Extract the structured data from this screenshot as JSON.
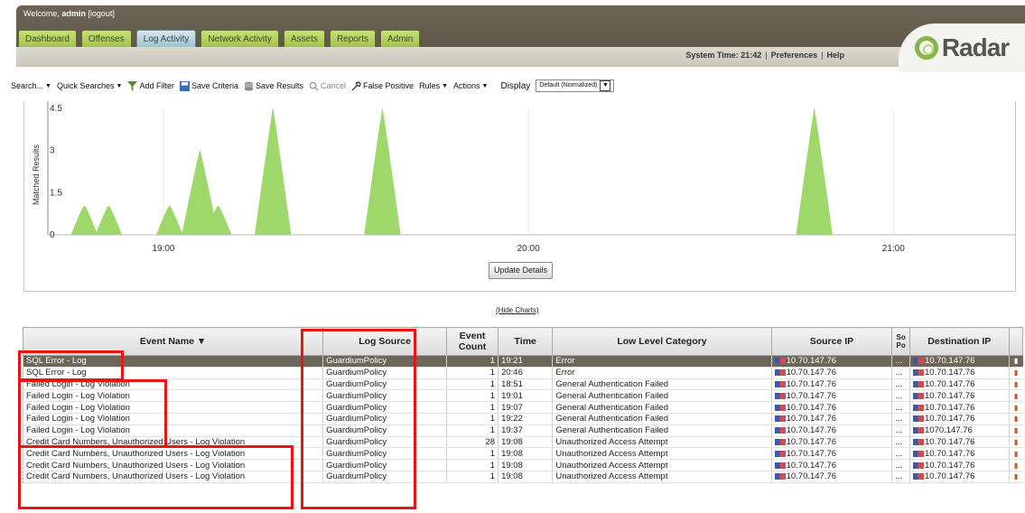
{
  "header": {
    "welcome_prefix": "Welcome, ",
    "user": "admin",
    "logout": "[logout]",
    "tabs": [
      {
        "label": "Dashboard"
      },
      {
        "label": "Offenses"
      },
      {
        "label": "Log Activity"
      },
      {
        "label": "Network Activity"
      },
      {
        "label": "Assets"
      },
      {
        "label": "Reports"
      },
      {
        "label": "Admin"
      }
    ],
    "active_tab": "Log Activity",
    "system_time_label": "System Time: 21:42",
    "preferences": "Preferences",
    "help": "Help",
    "logo_text": "Radar"
  },
  "toolbar": {
    "search": "Search...",
    "quick_searches": "Quick Searches",
    "add_filter": "Add Filter",
    "save_criteria": "Save Criteria",
    "save_results": "Save Results",
    "cancel": "Cancel",
    "false_positive": "False Positive",
    "rules": "Rules",
    "actions": "Actions",
    "display_label": "Display",
    "display_value": "Default (Normalized)"
  },
  "chart_data": {
    "type": "area",
    "ylabel": "Matched Results",
    "y_ticks": [
      "0",
      "1.5",
      "3",
      "4.5"
    ],
    "ylim": [
      0,
      4.5
    ],
    "x_ticks": [
      "19:00",
      "20:00",
      "21:00"
    ],
    "x_tick_minutes": [
      0,
      60,
      120
    ],
    "x_range_minutes": [
      -19,
      140
    ],
    "color": "#9ed86a",
    "peaks": [
      {
        "minute": -13,
        "value": 1
      },
      {
        "minute": -9,
        "value": 1
      },
      {
        "minute": 1,
        "value": 1
      },
      {
        "minute": 6,
        "value": 3
      },
      {
        "minute": 9,
        "value": 1
      },
      {
        "minute": 18,
        "value": 4.5
      },
      {
        "minute": 36,
        "value": 4.5
      },
      {
        "minute": 107,
        "value": 4.5
      }
    ],
    "update_button": "Update Details",
    "hide_charts": "(Hide Charts)"
  },
  "table": {
    "columns": [
      "Event Name ▼",
      "Log Source",
      "Event Count",
      "Time",
      "Low Level Category",
      "Source IP",
      "So Po",
      "Destination IP"
    ],
    "rows": [
      {
        "event_name": "SQL Error - Log",
        "log_source": "GuardiumPolicy",
        "count": "1",
        "time": "19:21",
        "category": "Error",
        "source_ip": "10.70.147.76",
        "sp": "...",
        "dest_ip": "10.70.147.76",
        "selected": true
      },
      {
        "event_name": "SQL Error - Log",
        "log_source": "GuardiumPolicy",
        "count": "1",
        "time": "20:46",
        "category": "Error",
        "source_ip": "10.70.147.76",
        "sp": "...",
        "dest_ip": "10.70.147.76"
      },
      {
        "event_name": "Failed Login - Log Violation",
        "log_source": "GuardiumPolicy",
        "count": "1",
        "time": "18:51",
        "category": "General Authentication Failed",
        "source_ip": "10.70.147.76",
        "sp": "...",
        "dest_ip": "10.70.147.76"
      },
      {
        "event_name": "Failed Login - Log Violation",
        "log_source": "GuardiumPolicy",
        "count": "1",
        "time": "19:01",
        "category": "General Authentication Failed",
        "source_ip": "10.70.147.76",
        "sp": "...",
        "dest_ip": "10.70.147.76"
      },
      {
        "event_name": "Failed Login - Log Violation",
        "log_source": "GuardiumPolicy",
        "count": "1",
        "time": "19:07",
        "category": "General Authentication Failed",
        "source_ip": "10.70.147.76",
        "sp": "...",
        "dest_ip": "10.70.147.76"
      },
      {
        "event_name": "Failed Login - Log Violation",
        "log_source": "GuardiumPolicy",
        "count": "1",
        "time": "19:22",
        "category": "General Authentication Failed",
        "source_ip": "10.70.147.76",
        "sp": "...",
        "dest_ip": "10.70.147.76"
      },
      {
        "event_name": "Failed Login - Log Violation",
        "log_source": "GuardiumPolicy",
        "count": "1",
        "time": "19:37",
        "category": "General Authentication Failed",
        "source_ip": "10.70.147.76",
        "sp": "...",
        "dest_ip": "1070.147.76"
      },
      {
        "event_name": "Credit Card Numbers, Unauthorized Users - Log Violation",
        "log_source": "GuardiumPolicy",
        "count": "28",
        "time": "19:08",
        "category": "Unauthorized Access Attempt",
        "source_ip": "10.70.147.76",
        "sp": "...",
        "dest_ip": "10.70.147.76"
      },
      {
        "event_name": "Credit Card Numbers, Unauthorized Users - Log Violation",
        "log_source": "GuardiumPolicy",
        "count": "1",
        "time": "19:08",
        "category": "Unauthorized Access Attempt",
        "source_ip": "10.70.147.76",
        "sp": "...",
        "dest_ip": "10.70.147.76"
      },
      {
        "event_name": "Credit Card Numbers, Unauthorized Users - Log Violation",
        "log_source": "GuardiumPolicy",
        "count": "1",
        "time": "19:08",
        "category": "Unauthorized Access Attempt",
        "source_ip": "10.70.147.76",
        "sp": "...",
        "dest_ip": "10.70.147.76"
      },
      {
        "event_name": "Credit Card Numbers, Unauthorized Users - Log Violation",
        "log_source": "GuardiumPolicy",
        "count": "1",
        "time": "19:08",
        "category": "Unauthorized Access Attempt",
        "source_ip": "10.70.147.76",
        "sp": "...",
        "dest_ip": "10.70.147.76"
      }
    ]
  },
  "colors": {
    "highlight": "#e81515",
    "selected_row": "#6d675b",
    "chart_fill": "#9ed86a"
  }
}
